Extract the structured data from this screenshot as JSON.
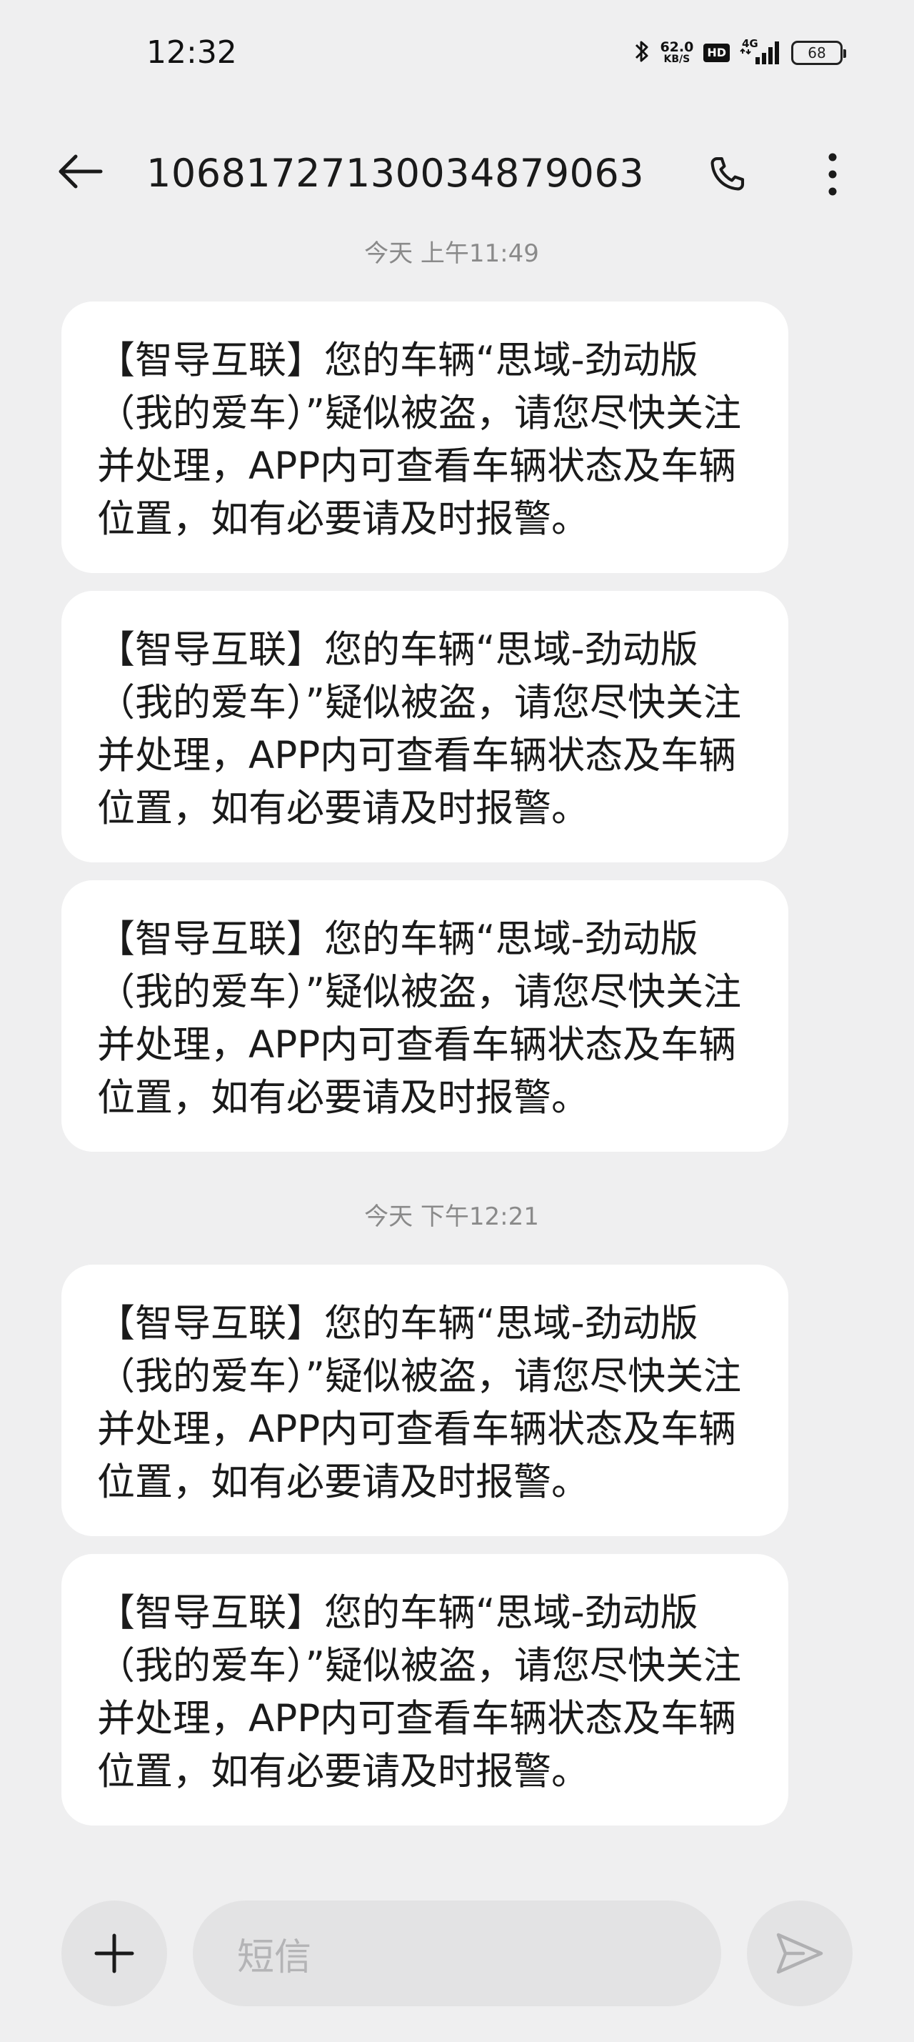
{
  "status_bar": {
    "time": "12:32",
    "net_speed_value": "62.0",
    "net_speed_unit": "KB/S",
    "hd_label": "HD",
    "network_type": "4G",
    "battery_level": "68"
  },
  "header": {
    "contact_number": "10681727130034879063"
  },
  "messages": {
    "groups": [
      {
        "timestamp": "今天 上午11:49",
        "items": [
          "【智导互联】您的车辆“思域-劲动版（我的爱车）”疑似被盗，请您尽快关注并处理，APP内可查看车辆状态及车辆位置，如有必要请及时报警。",
          "【智导互联】您的车辆“思域-劲动版（我的爱车）”疑似被盗，请您尽快关注并处理，APP内可查看车辆状态及车辆位置，如有必要请及时报警。",
          "【智导互联】您的车辆“思域-劲动版（我的爱车）”疑似被盗，请您尽快关注并处理，APP内可查看车辆状态及车辆位置，如有必要请及时报警。"
        ]
      },
      {
        "timestamp": "今天 下午12:21",
        "items": [
          "【智导互联】您的车辆“思域-劲动版（我的爱车）”疑似被盗，请您尽快关注并处理，APP内可查看车辆状态及车辆位置，如有必要请及时报警。",
          "【智导互联】您的车辆“思域-劲动版（我的爱车）”疑似被盗，请您尽快关注并处理，APP内可查看车辆状态及车辆位置，如有必要请及时报警。"
        ]
      }
    ]
  },
  "composer": {
    "placeholder": "短信"
  },
  "icons": {
    "back": "arrow-left-icon",
    "call": "phone-icon",
    "more": "more-vertical-icon",
    "add": "plus-icon",
    "send": "send-icon",
    "bluetooth": "bluetooth-icon",
    "signal": "signal-icon",
    "battery": "battery-icon"
  }
}
